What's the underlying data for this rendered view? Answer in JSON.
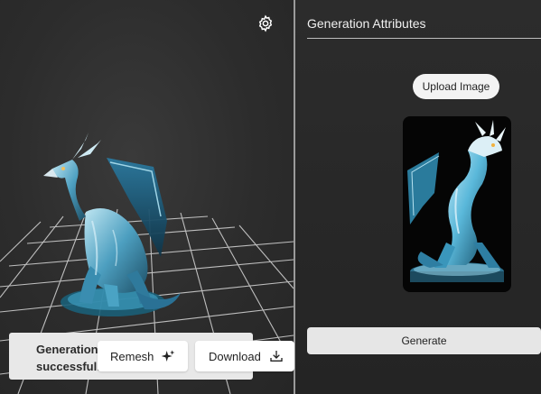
{
  "viewport": {
    "settings_icon": "gear-icon"
  },
  "toast": {
    "message": "Generation successful!"
  },
  "actions": {
    "remesh_label": "Remesh",
    "remesh_icon": "sparkle-icon",
    "download_label": "Download",
    "download_icon": "download-icon"
  },
  "panel": {
    "title": "Generation Attributes",
    "upload_label": "Upload Image",
    "generate_label": "Generate"
  },
  "colors": {
    "background": "#2a2a2a",
    "panel_background": "#262626",
    "button": "#ffffff",
    "model_accent": "#5fb8d8"
  }
}
